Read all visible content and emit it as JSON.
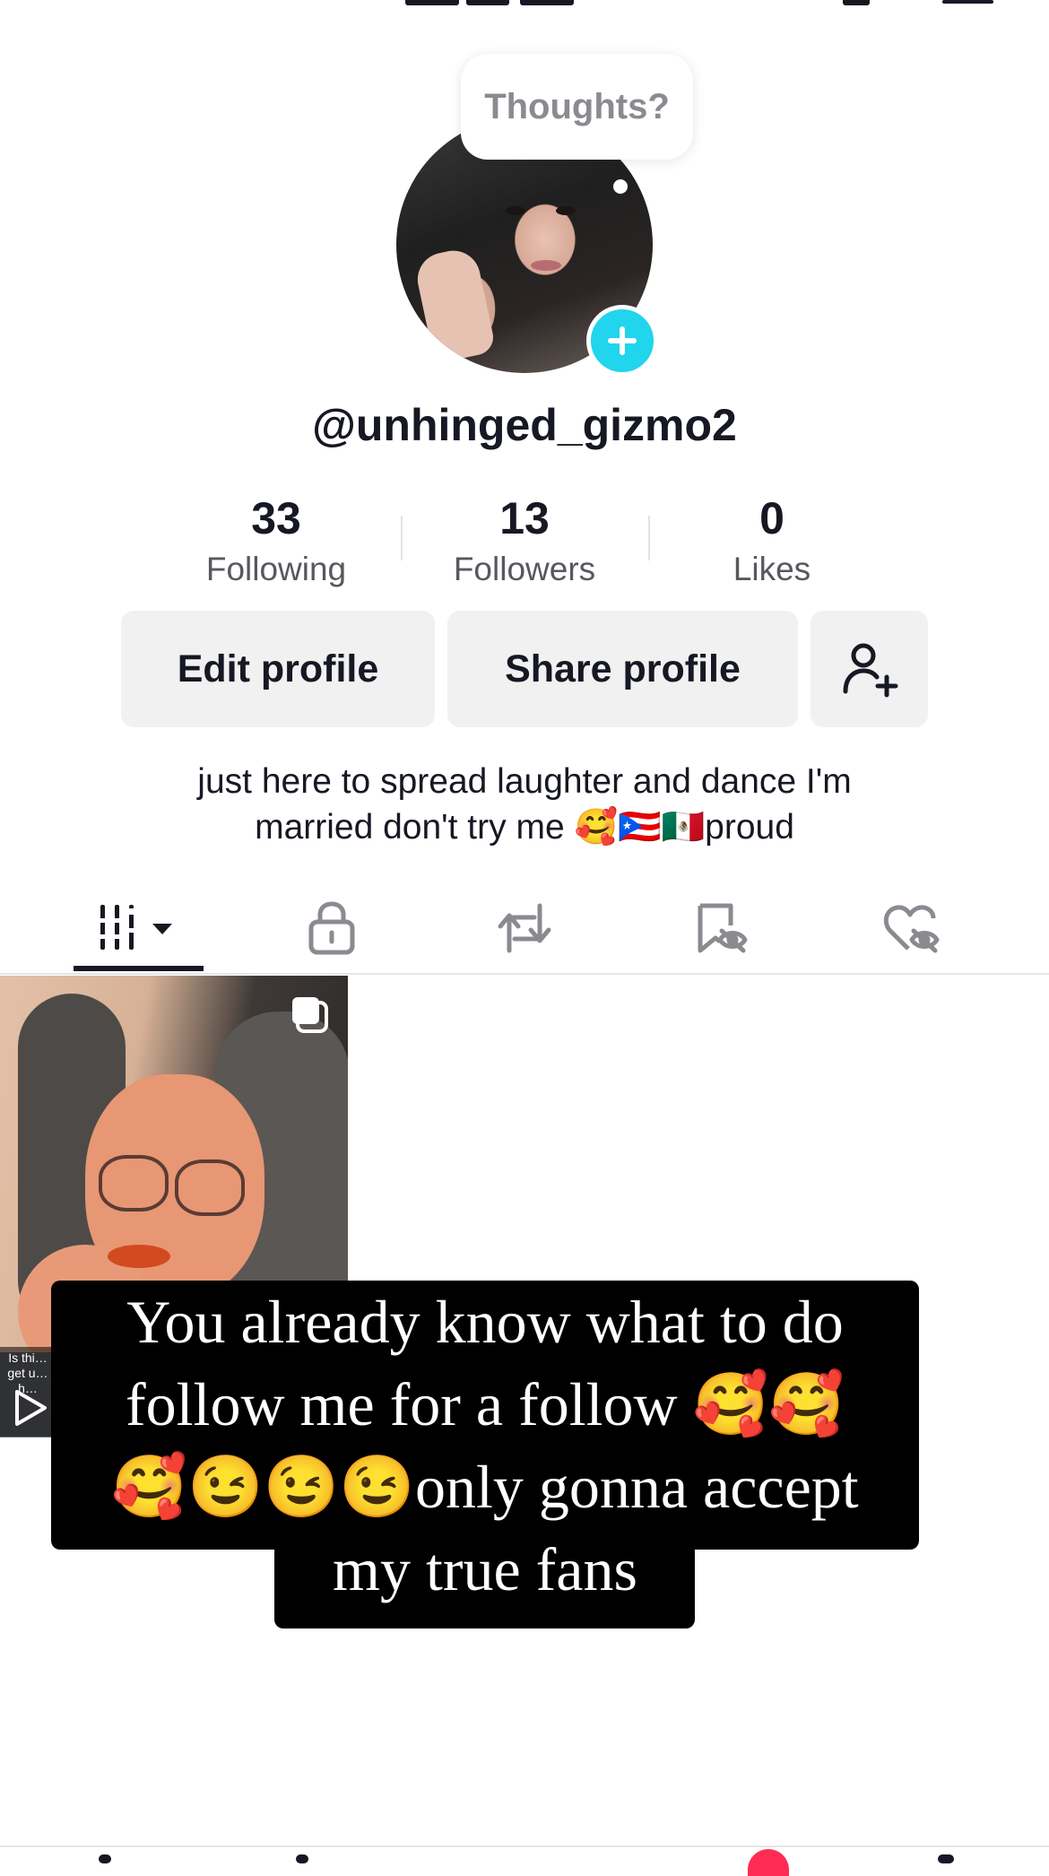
{
  "profile": {
    "username": "@unhinged_gizmo2",
    "thought_bubble": "Thoughts?",
    "bio_line1": "just here to spread laughter and dance I'm",
    "bio_line2": "married don't try me 🥰🇵🇷🇲🇽proud"
  },
  "stats": [
    {
      "value": "33",
      "label": "Following"
    },
    {
      "value": "13",
      "label": "Followers"
    },
    {
      "value": "0",
      "label": "Likes"
    }
  ],
  "actions": {
    "edit_profile": "Edit profile",
    "share_profile": "Share profile",
    "add_friend_icon": "add-person-icon"
  },
  "tabs": [
    {
      "name": "videos-grid",
      "icon": "grid-icon",
      "active": true
    },
    {
      "name": "private",
      "icon": "lock-icon"
    },
    {
      "name": "reposts",
      "icon": "repost-icon"
    },
    {
      "name": "favorites",
      "icon": "bookmark-hidden-icon"
    },
    {
      "name": "liked",
      "icon": "heart-hidden-icon"
    }
  ],
  "video_thumb": {
    "caption": "Is thi… get u… h…"
  },
  "overlay": {
    "line1": "You already know what to do",
    "line2": "follow me for a follow 🥰🥰",
    "line3": "🥰😉😉😉only gonna accept",
    "line4": "my true fans"
  },
  "colors": {
    "accent_cyan": "#20d5ec",
    "text_primary": "#161823",
    "button_bg": "#f1f1f2",
    "notification_red": "#fe2c55"
  }
}
